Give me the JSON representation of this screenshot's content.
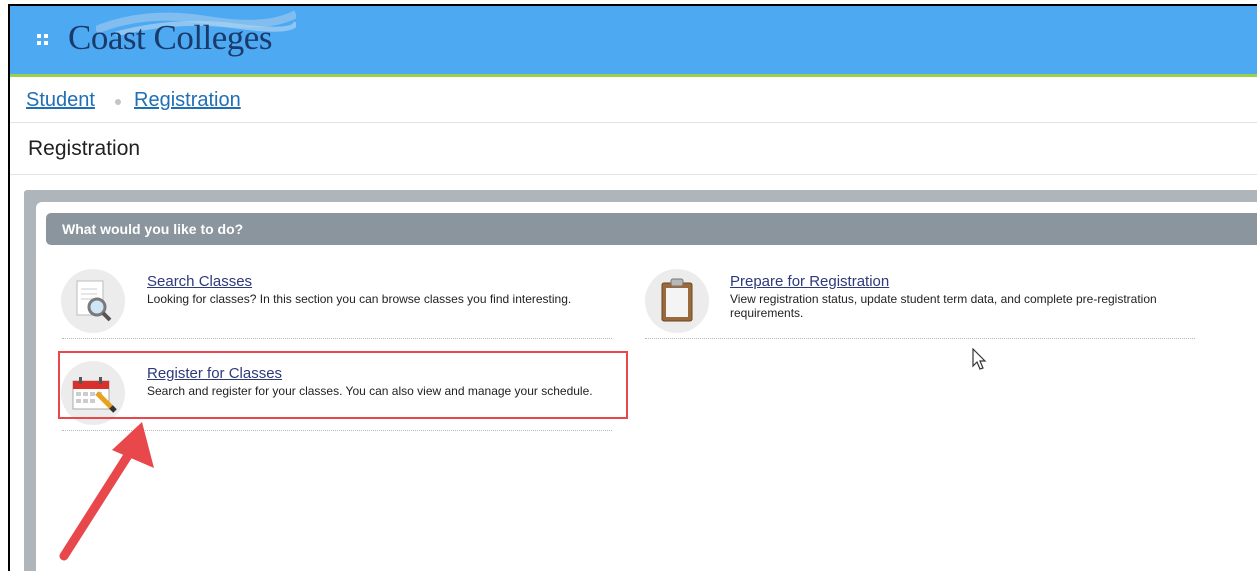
{
  "header": {
    "logo_text": "Coast Colleges"
  },
  "breadcrumb": {
    "items": [
      {
        "label": "Student"
      },
      {
        "label": "Registration"
      }
    ]
  },
  "page": {
    "title": "Registration"
  },
  "panel": {
    "header": "What would you like to do?",
    "options": [
      {
        "label": "Search Classes",
        "description": "Looking for classes? In this section you can browse classes you find interesting."
      },
      {
        "label": "Prepare for Registration",
        "description": "View registration status, update student term data, and complete pre-registration requirements."
      },
      {
        "label": "Register for Classes",
        "description": "Search and register for your classes. You can also view and manage your schedule."
      }
    ]
  },
  "colors": {
    "topbar": "#4ea9f3",
    "accent_line": "#9ccf4a",
    "panel_header": "#8a959d",
    "link": "#2d3a7c",
    "annotation": "#e8484c"
  }
}
